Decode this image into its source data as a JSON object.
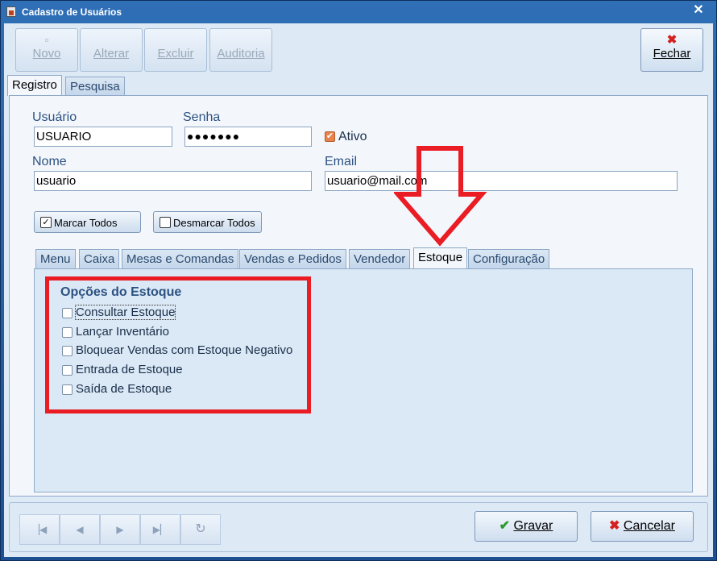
{
  "window": {
    "title": "Cadastro de Usuários",
    "close_glyph": "✕"
  },
  "toolbar": {
    "novo": "Novo",
    "alterar": "Alterar",
    "excluir": "Excluir",
    "auditoria": "Auditoria",
    "fechar": "Fechar"
  },
  "main_tabs": [
    "Registro",
    "Pesquisa"
  ],
  "form": {
    "usuario_label": "Usuário",
    "usuario_value": "USUARIO",
    "senha_label": "Senha",
    "senha_value": "●●●●●●●",
    "ativo_label": "Ativo",
    "ativo_checked": true,
    "nome_label": "Nome",
    "nome_value": "usuario",
    "email_label": "Email",
    "email_value": "usuario@mail.com"
  },
  "buttons": {
    "marcar_todos": "Marcar Todos",
    "desmarcar_todos": "Desmarcar Todos"
  },
  "perm_tabs": [
    "Menu",
    "Caixa",
    "Mesas e Comandas",
    "Vendas e Pedidos",
    "Vendedor",
    "Estoque",
    "Configuração"
  ],
  "selected_perm_tab": "Estoque",
  "estoque": {
    "title": "Opções do Estoque",
    "options": [
      "Consultar Estoque",
      "Lançar Inventário",
      "Bloquear Vendas com Estoque Negativo",
      "Entrada de Estoque",
      "Saída de Estoque"
    ]
  },
  "footer": {
    "gravar": "Gravar",
    "cancelar": "Cancelar"
  },
  "colors": {
    "annotation_red": "#ea1c24",
    "accent_blue": "#2c5282",
    "checked_orange": "#e8834d"
  }
}
